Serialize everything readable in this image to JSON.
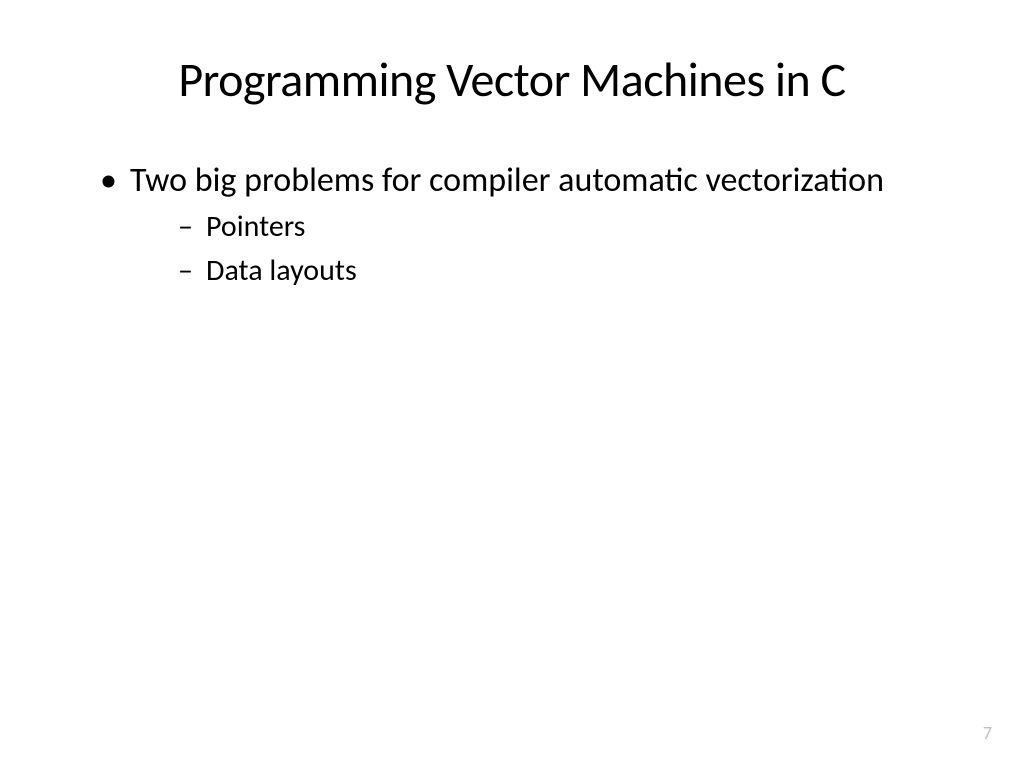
{
  "slide": {
    "title": "Programming Vector Machines in C",
    "bullets": [
      {
        "text": "Two big problems for compiler automatic vectorization",
        "sub": [
          "Pointers",
          "Data layouts"
        ]
      }
    ],
    "page_number": "7"
  }
}
